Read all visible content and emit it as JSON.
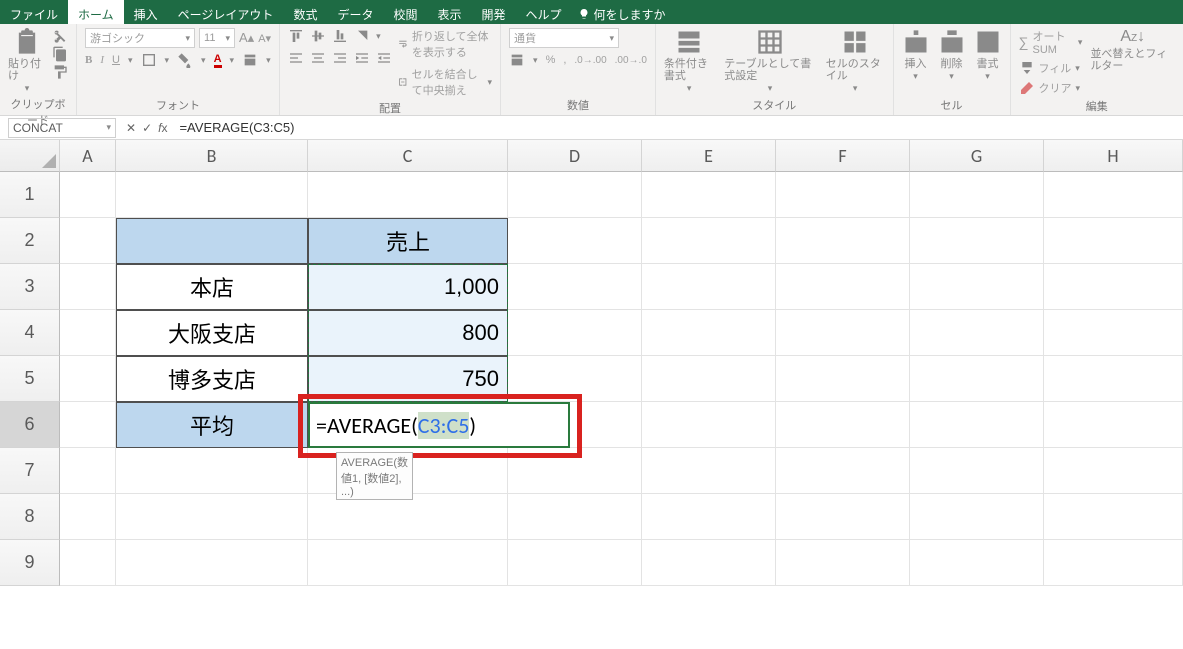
{
  "tabs": {
    "file": "ファイル",
    "home": "ホーム",
    "insert": "挿入",
    "page_layout": "ページレイアウト",
    "formulas": "数式",
    "data": "データ",
    "review": "校閲",
    "view": "表示",
    "developer": "開発",
    "help": "ヘルプ",
    "tell_me": "何をしますか"
  },
  "ribbon": {
    "paste": "貼り付け",
    "clipboard": "クリップボード",
    "font_name": "游ゴシック",
    "font_size": "11",
    "font_group": "フォント",
    "wrap": "折り返して全体を表示する",
    "merge": "セルを結合して中央揃え",
    "align_group": "配置",
    "num_format": "通貨",
    "num_group": "数値",
    "cond": "条件付き書式",
    "table": "テーブルとして書式設定",
    "styles": "セルのスタイル",
    "style_group": "スタイル",
    "ins": "挿入",
    "del": "削除",
    "fmt": "書式",
    "cell_group": "セル",
    "autosum": "オート SUM",
    "fill": "フィル",
    "clear": "クリア",
    "edit_group": "編集",
    "sort": "並べ替えとフィルター"
  },
  "name_box": "CONCAT",
  "formula": "=AVERAGE(C3:C5)",
  "columns": [
    "A",
    "B",
    "C",
    "D",
    "E",
    "F",
    "G",
    "H"
  ],
  "rows": [
    "1",
    "2",
    "3",
    "4",
    "5",
    "6",
    "7",
    "8",
    "9"
  ],
  "table": {
    "c2": "売上",
    "b3": "本店",
    "c3": "1,000",
    "b4": "大阪支店",
    "c4": "800",
    "b5": "博多支店",
    "c5": "750",
    "b6": "平均"
  },
  "edit": {
    "pre": "=AVERAGE(",
    "rng": "C3:C5",
    "post": ")"
  },
  "tooltip": "AVERAGE(数値1, [数値2], ...)",
  "chart_data": {
    "type": "table",
    "title": "売上",
    "categories": [
      "本店",
      "大阪支店",
      "博多支店"
    ],
    "values": [
      1000,
      800,
      750
    ],
    "aggregate": {
      "label": "平均",
      "formula": "=AVERAGE(C3:C5)"
    }
  }
}
